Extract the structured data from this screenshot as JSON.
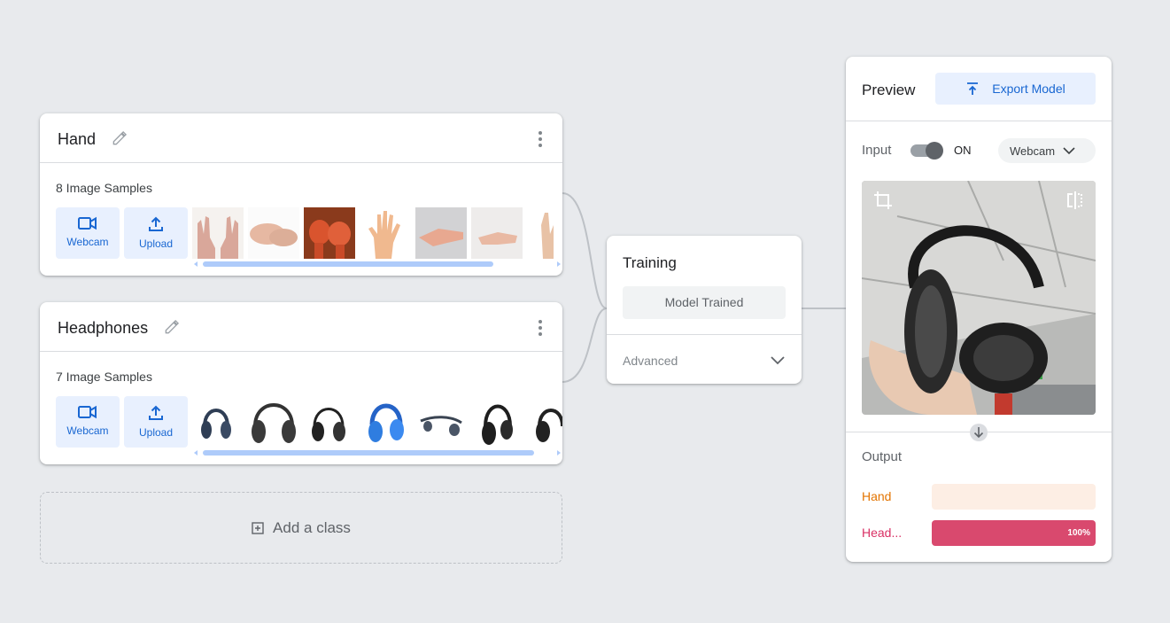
{
  "classes": [
    {
      "name": "Hand",
      "samples_label": "8 Image Samples",
      "webcam_label": "Webcam",
      "upload_label": "Upload"
    },
    {
      "name": "Headphones",
      "samples_label": "7 Image Samples",
      "webcam_label": "Webcam",
      "upload_label": "Upload"
    }
  ],
  "add_class_label": "Add a class",
  "training": {
    "title": "Training",
    "button_label": "Model Trained",
    "advanced_label": "Advanced"
  },
  "preview": {
    "title": "Preview",
    "export_label": "Export Model",
    "input_label": "Input",
    "toggle_state": "ON",
    "source_select": "Webcam",
    "output_label": "Output",
    "outputs": [
      {
        "label": "Hand",
        "value": 0,
        "color": "#e37400",
        "bar_bg": "#fdeee4",
        "fill": "#e37400",
        "pct_text": ""
      },
      {
        "label": "Head...",
        "value": 1.0,
        "color": "#d93064",
        "bar_bg": "#fce8ee",
        "fill": "#d9496e",
        "pct_text": "100%"
      }
    ]
  },
  "colors": {
    "accent": "#1967d2",
    "accent_bg": "#e8f0fe",
    "background": "#e8eaed"
  }
}
